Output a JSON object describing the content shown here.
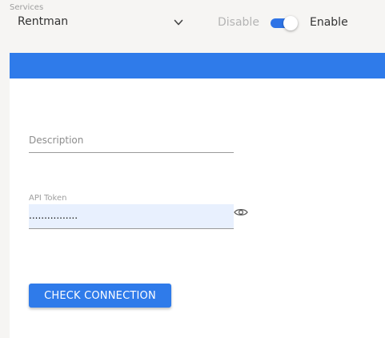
{
  "topbar": {
    "services_label": "Services",
    "selected_service": "Rentman",
    "disable_label": "Disable",
    "enable_label": "Enable",
    "toggle_state": "on"
  },
  "form": {
    "description_placeholder": "Description",
    "description_value": "",
    "token_label": "API Token",
    "token_value": "................",
    "check_button_label": "CHECK CONNECTION"
  },
  "icons": {
    "dropdown": "chevron-down-icon",
    "reveal": "eye-icon"
  },
  "colors": {
    "accent": "#2f7bea",
    "autofill_bg": "#e8f0fe",
    "page_bg": "#f6f5f3"
  }
}
